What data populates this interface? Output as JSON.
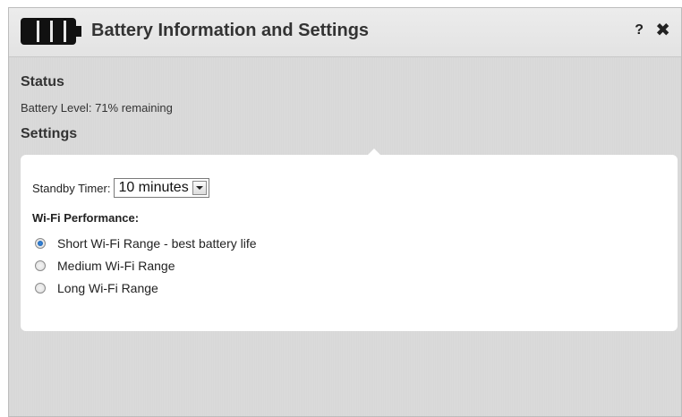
{
  "dialog": {
    "title": "Battery Information and Settings",
    "help_label": "?",
    "close_label": "✖",
    "accent_color": "#1659a8"
  },
  "status": {
    "heading": "Status",
    "battery_level_text": "Battery Level: 71% remaining",
    "battery_level_percent": 71
  },
  "settings": {
    "heading": "Settings",
    "standby_timer": {
      "label": "Standby Timer:",
      "selected": "10 minutes"
    },
    "wifi_performance": {
      "heading": "Wi-Fi Performance:",
      "options": [
        {
          "label": "Short Wi-Fi Range - best battery life",
          "checked": true
        },
        {
          "label": "Medium Wi-Fi Range",
          "checked": false
        },
        {
          "label": "Long Wi-Fi Range",
          "checked": false
        }
      ]
    }
  },
  "icons": {
    "battery": "battery-icon",
    "help": "help-icon",
    "close": "close-icon",
    "dropdown": "chevron-down-icon"
  }
}
